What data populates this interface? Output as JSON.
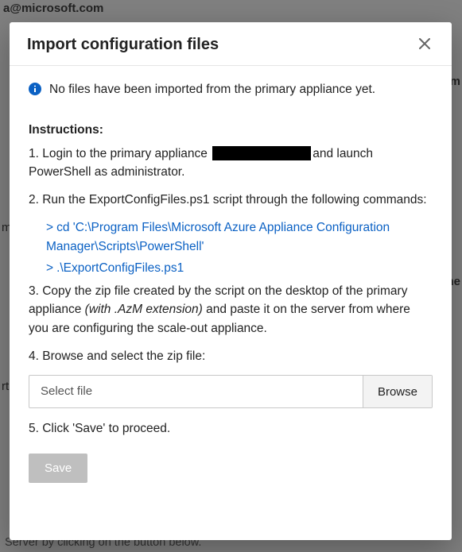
{
  "background": {
    "email_fragment": "a@microsoft.com",
    "right1": "om",
    "right2": "ne",
    "left1": "m",
    "left2": "rt",
    "bottom_fragment": "Server by clicking on the button below."
  },
  "modal": {
    "title": "Import configuration files",
    "info_message": "No files have been imported from the primary appliance yet.",
    "instructions_heading": "Instructions:",
    "steps": {
      "s1a": "1. Login to the primary appliance ",
      "s1b": "and launch PowerShell as administrator.",
      "s2": "2. Run the ExportConfigFiles.ps1 script through the following commands:",
      "cmd1": "cd 'C:\\Program Files\\Microsoft Azure Appliance Configuration Manager\\Scripts\\PowerShell'",
      "cmd2": ".\\ExportConfigFiles.ps1",
      "s3a": "3. Copy the zip file created by the script on the desktop of the primary appliance ",
      "s3_italic": "(with .AzM extension)",
      "s3b": " and paste it on the server from where you are configuring the scale-out appliance.",
      "s4": "4. Browse and select the zip file:",
      "s5": "5. Click 'Save' to proceed."
    },
    "file_placeholder": "Select file",
    "browse_label": "Browse",
    "save_label": "Save",
    "colors": {
      "link": "#0b61c4",
      "info_icon": "#0b61c4",
      "save_bg": "#bfbfbf"
    }
  }
}
